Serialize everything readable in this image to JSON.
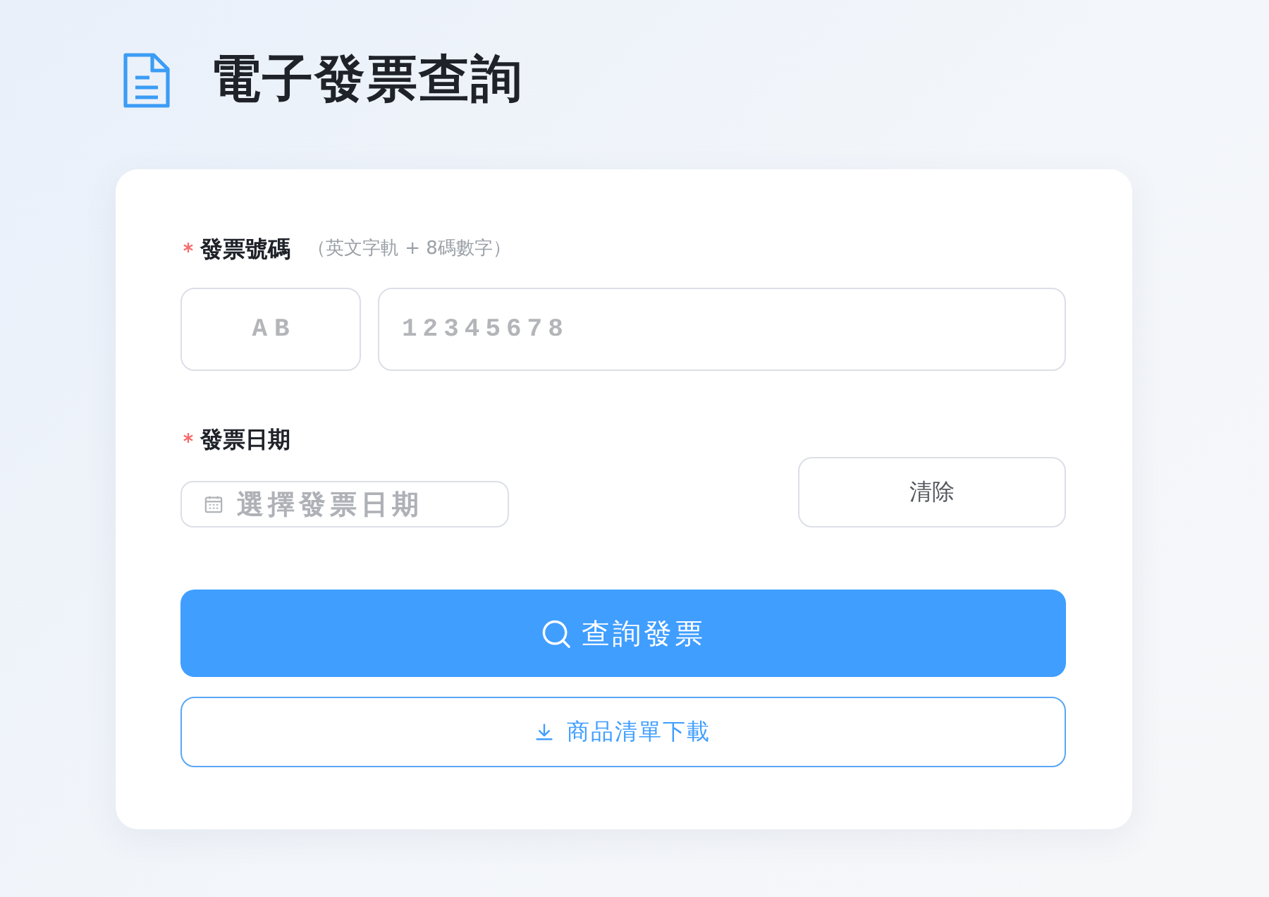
{
  "header": {
    "title": "電子發票查詢"
  },
  "invoice_number": {
    "label": "發票號碼",
    "required": true,
    "hint": "（英文字軌 + 8碼數字）",
    "prefix_field": {
      "placeholder": "AB"
    },
    "number_field": {
      "placeholder": "12345678"
    }
  },
  "invoice_date": {
    "label": "發票日期",
    "required": true,
    "date_field": {
      "placeholder": "選擇發票日期"
    },
    "clear_button": "清除"
  },
  "search_button": "查詢發票",
  "download_button": "商品清單下載"
}
